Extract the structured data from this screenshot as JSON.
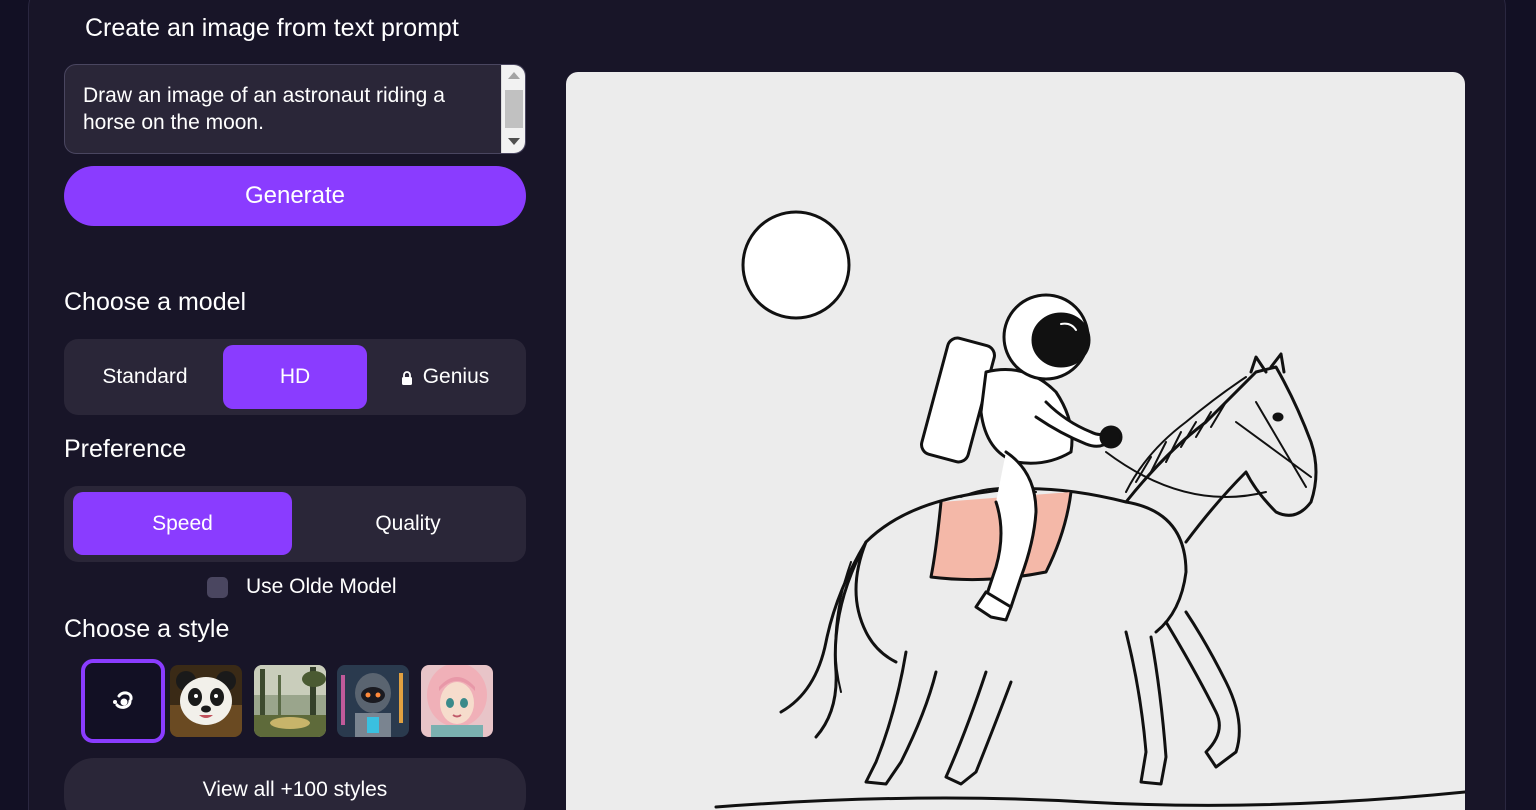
{
  "header": {
    "title": "Create an image from text prompt"
  },
  "prompt": {
    "value": "Draw an image of an astronaut riding a horse on the moon."
  },
  "generate": {
    "label": "Generate"
  },
  "model": {
    "label": "Choose a model",
    "options": [
      "Standard",
      "HD",
      "Genius"
    ],
    "selected": "HD",
    "locked_option_icon": "lock-icon"
  },
  "preference": {
    "label": "Preference",
    "options": [
      "Speed",
      "Quality"
    ],
    "selected": "Speed"
  },
  "old_model": {
    "label": "Use Olde Model",
    "checked": false
  },
  "style": {
    "label": "Choose a style",
    "thumbs": [
      "no-style-icon",
      "panda-thumb",
      "forest-landscape-thumb",
      "robot-thumb",
      "anime-girl-thumb"
    ],
    "selected_index": 0,
    "view_all_label": "View all +100 styles"
  },
  "colors": {
    "accent": "#8a3cff",
    "panel": "#2a2638",
    "background": "#121024"
  }
}
